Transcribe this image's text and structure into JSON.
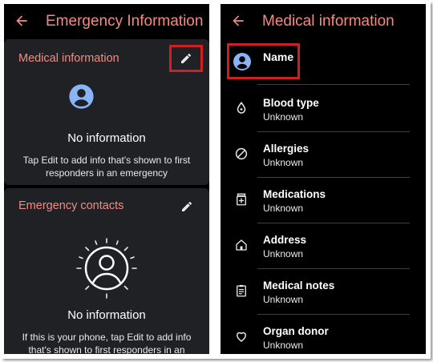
{
  "colors": {
    "accent": "#f28b82",
    "highlight": "#d01f1f",
    "background": "#000000",
    "card": "#202124",
    "avatar": "#8ab4f8"
  },
  "left": {
    "title": "Emergency Information",
    "medical_card": {
      "title": "Medical information",
      "empty_title": "No information",
      "hint": "Tap Edit to add info that's shown to first responders in an emergency"
    },
    "contacts_card": {
      "title": "Emergency contacts",
      "empty_title": "No information",
      "hint": "If this is your phone, tap Edit to add info that's shown to first responders in an"
    }
  },
  "right": {
    "title": "Medical information",
    "name_label": "Name",
    "items": [
      {
        "label": "Blood type",
        "value": "Unknown",
        "icon": "blood-drop-icon"
      },
      {
        "label": "Allergies",
        "value": "Unknown",
        "icon": "no-symbol-icon"
      },
      {
        "label": "Medications",
        "value": "Unknown",
        "icon": "medication-icon"
      },
      {
        "label": "Address",
        "value": "Unknown",
        "icon": "home-icon"
      },
      {
        "label": "Medical notes",
        "value": "Unknown",
        "icon": "clipboard-icon"
      },
      {
        "label": "Organ donor",
        "value": "Unknown",
        "icon": "heart-icon"
      }
    ]
  }
}
